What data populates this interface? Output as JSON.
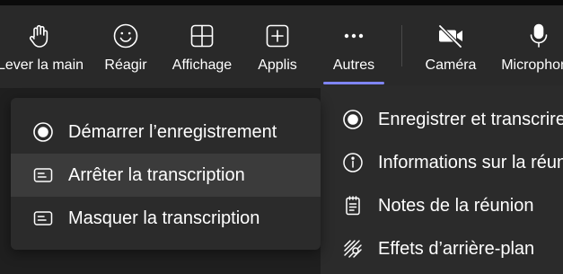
{
  "toolbar": {
    "items": [
      {
        "label": "Lever la main",
        "icon": "raise-hand-icon"
      },
      {
        "label": "Réagir",
        "icon": "smiley-icon"
      },
      {
        "label": "Affichage",
        "icon": "grid-view-icon"
      },
      {
        "label": "Applis",
        "icon": "add-app-icon"
      },
      {
        "label": "Autres",
        "icon": "more-dots-icon",
        "active": true
      },
      {
        "label": "Caméra",
        "icon": "camera-off-icon"
      },
      {
        "label": "Microphone",
        "icon": "microphone-icon"
      }
    ],
    "accent_color": "#7f85f5"
  },
  "submenu": {
    "items": [
      {
        "label": "Démarrer l’enregistrement",
        "icon": "record-icon"
      },
      {
        "label": "Arrêter la transcription",
        "icon": "transcript-icon",
        "hovered": true
      },
      {
        "label": "Masquer la transcription",
        "icon": "transcript-icon"
      }
    ]
  },
  "more_menu": {
    "items": [
      {
        "label": "Enregistrer et transcrire",
        "icon": "record-icon"
      },
      {
        "label": "Informations sur la réunion",
        "icon": "info-icon"
      },
      {
        "label": "Notes de la réunion",
        "icon": "notes-icon"
      },
      {
        "label": "Effets d’arrière-plan",
        "icon": "background-effects-icon"
      }
    ]
  }
}
